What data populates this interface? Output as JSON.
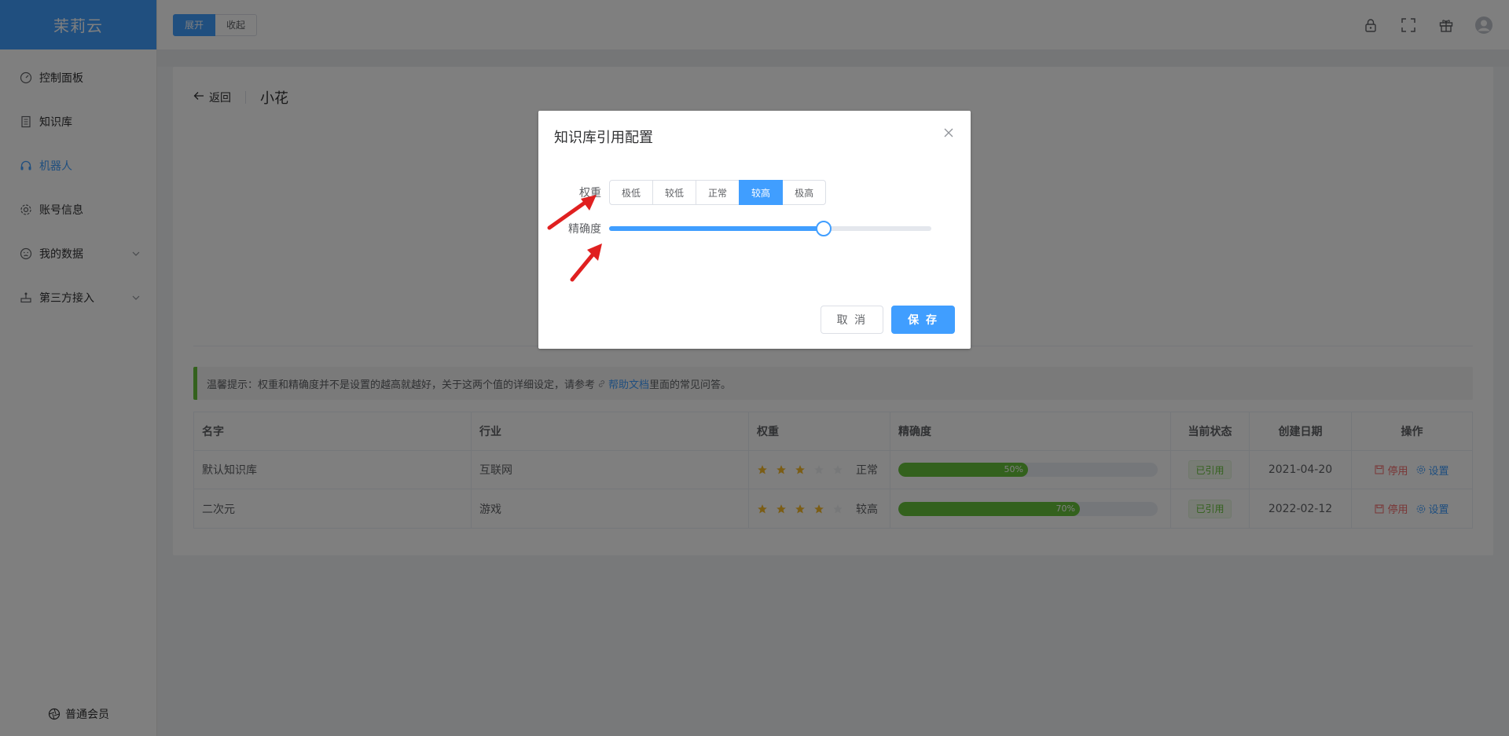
{
  "app": {
    "logo": "茉莉云"
  },
  "sidebar": {
    "items": [
      {
        "label": "控制面板",
        "icon": "gauge-icon"
      },
      {
        "label": "知识库",
        "icon": "book-icon"
      },
      {
        "label": "机器人",
        "icon": "headset-icon",
        "active": true
      },
      {
        "label": "账号信息",
        "icon": "gear-icon"
      },
      {
        "label": "我的数据",
        "icon": "face-icon",
        "expandable": true
      },
      {
        "label": "第三方接入",
        "icon": "plug-icon",
        "expandable": true
      }
    ],
    "member_label": "普通会员"
  },
  "header": {
    "expand_label": "展开",
    "collapse_label": "收起"
  },
  "page": {
    "back_label": "返回",
    "robot_name": "小花"
  },
  "tip": {
    "text_before": "温馨提示：权重和精确度并不是设置的越高就越好，关于这两个值的详细设定，请参考",
    "link_label": "帮助文档",
    "text_after": "里面的常见问答。"
  },
  "table": {
    "headers": {
      "name": "名字",
      "industry": "行业",
      "weight": "权重",
      "precision": "精确度",
      "status": "当前状态",
      "date": "创建日期",
      "ops": "操作"
    },
    "rows": [
      {
        "name": "默认知识库",
        "industry": "互联网",
        "stars": 3,
        "weight_label": "正常",
        "precision": 50,
        "precision_label": "50%",
        "status": "已引用",
        "date": "2021-04-20",
        "op_disable": "停用",
        "op_settings": "设置"
      },
      {
        "name": "二次元",
        "industry": "游戏",
        "stars": 4,
        "weight_label": "较高",
        "precision": 70,
        "precision_label": "70%",
        "status": "已引用",
        "date": "2022-02-12",
        "op_disable": "停用",
        "op_settings": "设置"
      }
    ]
  },
  "dialog": {
    "title": "知识库引用配置",
    "weight_label": "权重",
    "weight_options": [
      "极低",
      "较低",
      "正常",
      "较高",
      "极高"
    ],
    "weight_selected": "较高",
    "precision_label": "精确度",
    "precision_value": 0.665,
    "cancel_label": "取 消",
    "save_label": "保 存"
  },
  "colors": {
    "primary": "#409eff",
    "success": "#67c23a",
    "danger": "#f56c6c",
    "star": "#f7ba2a",
    "arrow": "#e02020"
  }
}
